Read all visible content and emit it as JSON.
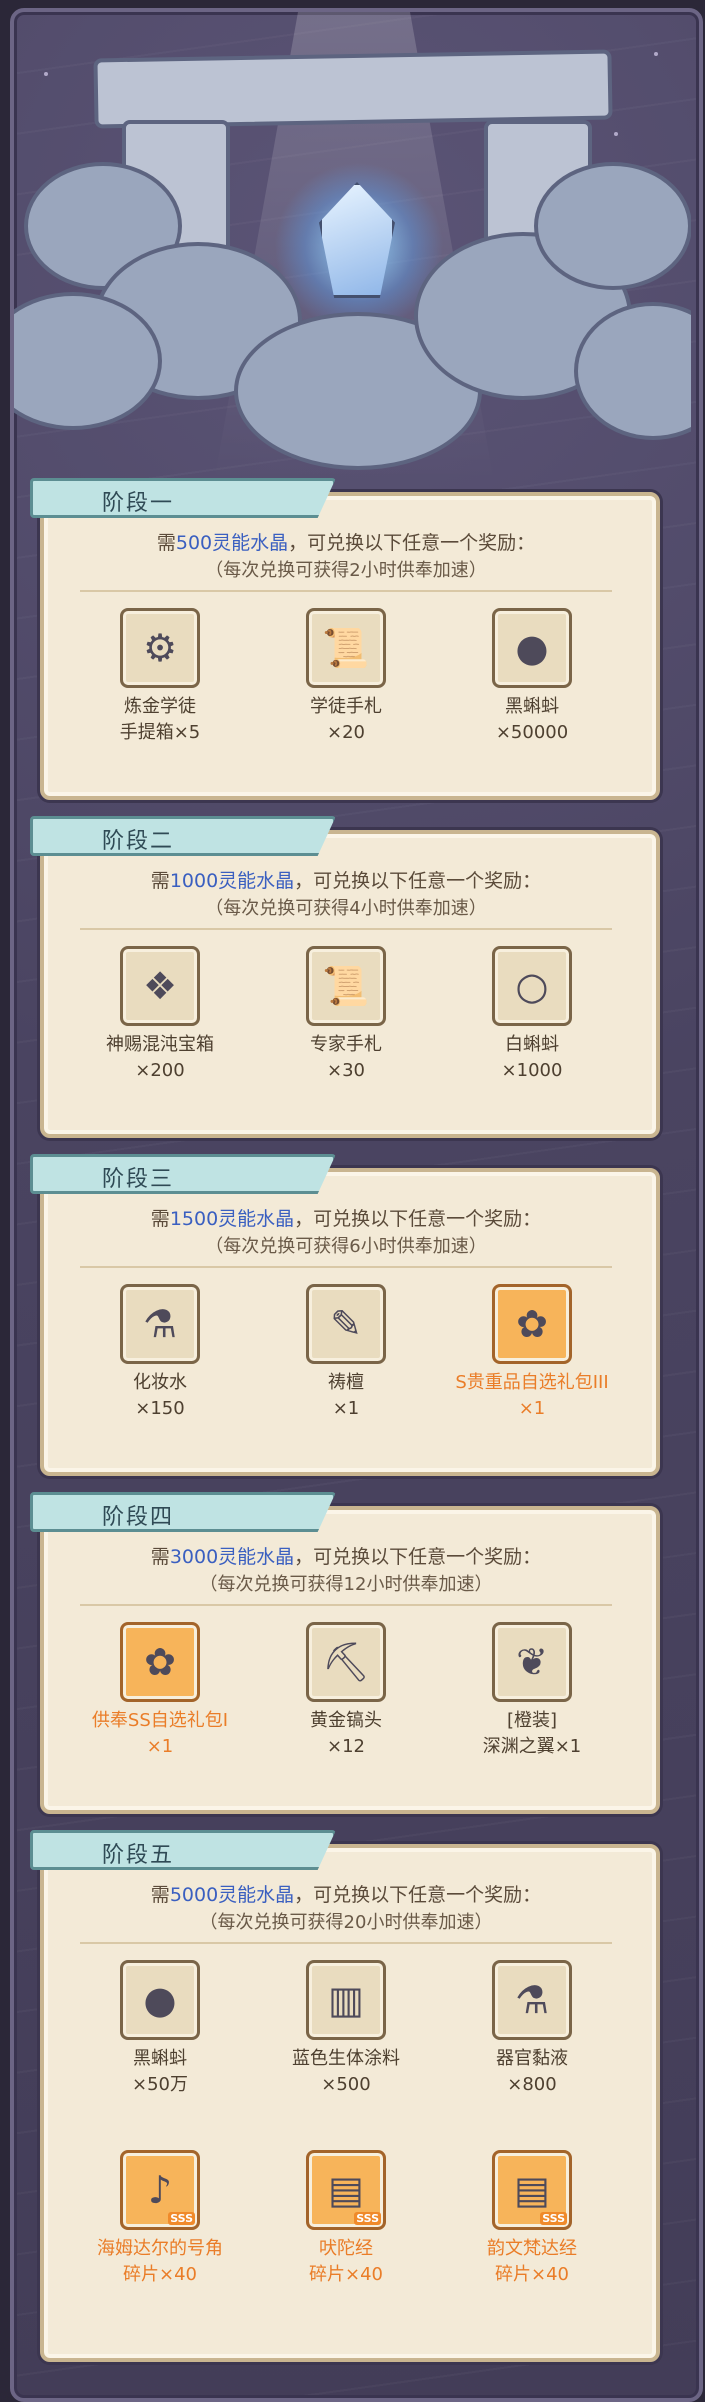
{
  "stages": [
    {
      "title": "阶段一",
      "req_prefix": "需",
      "req_amount": "500灵能水晶",
      "req_suffix": "，可兑换以下任意一个奖励：",
      "note": "（每次兑换可获得2小时供奉加速）",
      "items": [
        {
          "icon": "toolbox-icon",
          "glyph": "⚙",
          "name": "炼金学徒",
          "qty": "手提箱×5",
          "highlight": false
        },
        {
          "icon": "scroll-icon",
          "glyph": "📜",
          "name": "学徒手札",
          "qty": "×20",
          "highlight": false
        },
        {
          "icon": "black-tadpole-icon",
          "glyph": "●",
          "name": "黑蝌蚪",
          "qty": "×50000",
          "highlight": false
        }
      ]
    },
    {
      "title": "阶段二",
      "req_prefix": "需",
      "req_amount": "1000灵能水晶",
      "req_suffix": "，可兑换以下任意一个奖励：",
      "note": "（每次兑换可获得4小时供奉加速）",
      "items": [
        {
          "icon": "chaos-chest-icon",
          "glyph": "❖",
          "name": "神赐混沌宝箱",
          "qty": "×200",
          "highlight": false
        },
        {
          "icon": "expert-scroll-icon",
          "glyph": "📜",
          "name": "专家手札",
          "qty": "×30",
          "highlight": false
        },
        {
          "icon": "white-tadpole-icon",
          "glyph": "○",
          "name": "白蝌蚪",
          "qty": "×1000",
          "highlight": false
        }
      ]
    },
    {
      "title": "阶段三",
      "req_prefix": "需",
      "req_amount": "1500灵能水晶",
      "req_suffix": "，可兑换以下任意一个奖励：",
      "note": "（每次兑换可获得6小时供奉加速）",
      "items": [
        {
          "icon": "cosmetic-bottle-icon",
          "glyph": "⚗",
          "name": "化妆水",
          "qty": "×150",
          "highlight": false
        },
        {
          "icon": "incense-icon",
          "glyph": "✎",
          "name": "祷檀",
          "qty": "×1",
          "highlight": false
        },
        {
          "icon": "gift-pack-icon",
          "glyph": "✿",
          "name": "S贵重品自选礼包III",
          "qty": "×1",
          "highlight": true
        }
      ]
    },
    {
      "title": "阶段四",
      "req_prefix": "需",
      "req_amount": "3000灵能水晶",
      "req_suffix": "，可兑换以下任意一个奖励：",
      "note": "（每次兑换可获得12小时供奉加速）",
      "items": [
        {
          "icon": "ss-gift-pack-icon",
          "glyph": "✿",
          "name": "供奉SS自选礼包Ⅰ",
          "qty": "×1",
          "highlight": true
        },
        {
          "icon": "pickaxe-icon",
          "glyph": "⛏",
          "name": "黄金镐头",
          "qty": "×12",
          "highlight": false
        },
        {
          "icon": "abyss-wing-icon",
          "glyph": "❦",
          "name": "[橙装]",
          "qty": "深渊之翼×1",
          "highlight": false
        }
      ]
    },
    {
      "title": "阶段五",
      "req_prefix": "需",
      "req_amount": "5000灵能水晶",
      "req_suffix": "，可兑换以下任意一个奖励：",
      "note": "（每次兑换可获得20小时供奉加速）",
      "items": [
        {
          "icon": "black-tadpole-icon",
          "glyph": "●",
          "name": "黑蝌蚪",
          "qty": "×50万",
          "highlight": false
        },
        {
          "icon": "blue-paint-bucket-icon",
          "glyph": "▥",
          "name": "蓝色生体涂料",
          "qty": "×500",
          "highlight": false
        },
        {
          "icon": "organ-fluid-icon",
          "glyph": "⚗",
          "name": "器官黏液",
          "qty": "×800",
          "highlight": false
        },
        {
          "icon": "horn-icon",
          "glyph": "♪",
          "name": "海姆达尔的号角",
          "qty": "碎片×40",
          "highlight": true,
          "badge": "SSS"
        },
        {
          "icon": "scripture-book-icon",
          "glyph": "▤",
          "name": "吠陀经",
          "qty": "碎片×40",
          "highlight": true,
          "badge": "SSS"
        },
        {
          "icon": "vendidad-book-icon",
          "glyph": "▤",
          "name": "韵文梵达经",
          "qty": "碎片×40",
          "highlight": true,
          "badge": "SSS"
        }
      ]
    }
  ]
}
